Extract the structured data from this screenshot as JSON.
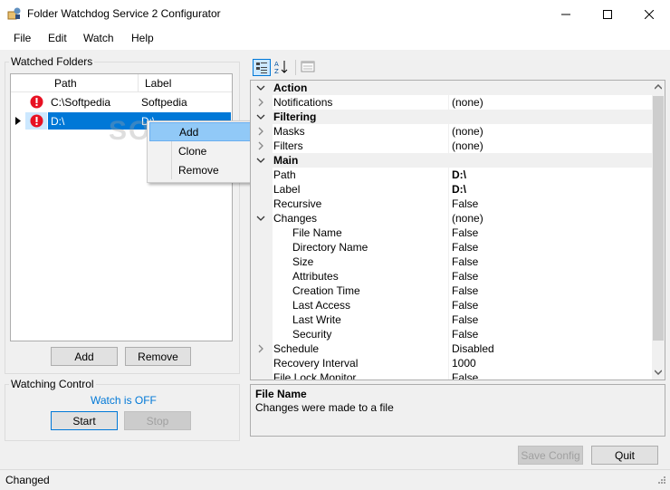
{
  "window": {
    "title": "Folder Watchdog Service 2 Configurator"
  },
  "menu": [
    "File",
    "Edit",
    "Watch",
    "Help"
  ],
  "watched_folders": {
    "label": "Watched Folders",
    "columns": [
      "Path",
      "Label"
    ],
    "rows": [
      {
        "path": "C:\\Softpedia",
        "label": "Softpedia"
      },
      {
        "path": "D:\\",
        "label": "D:\\"
      }
    ],
    "add_label": "Add",
    "remove_label": "Remove"
  },
  "context_menu": [
    "Add",
    "Clone",
    "Remove"
  ],
  "watching_control": {
    "label": "Watching Control",
    "status": "Watch is OFF",
    "start_label": "Start",
    "stop_label": "Stop"
  },
  "property_grid": {
    "rows": [
      {
        "type": "cat",
        "name": "Action"
      },
      {
        "type": "prop",
        "name": "Notifications",
        "value": "(none)",
        "expander": "right"
      },
      {
        "type": "cat",
        "name": "Filtering"
      },
      {
        "type": "prop",
        "name": "Masks",
        "value": "(none)",
        "expander": "right"
      },
      {
        "type": "prop",
        "name": "Filters",
        "value": "(none)",
        "expander": "right"
      },
      {
        "type": "cat",
        "name": "Main"
      },
      {
        "type": "prop",
        "name": "Path",
        "value": "D:\\",
        "bold": true
      },
      {
        "type": "prop",
        "name": "Label",
        "value": "D:\\",
        "bold": true
      },
      {
        "type": "prop",
        "name": "Recursive",
        "value": "False"
      },
      {
        "type": "prop",
        "name": "Changes",
        "value": "(none)",
        "expander": "down"
      },
      {
        "type": "sub",
        "name": "File Name",
        "value": "False"
      },
      {
        "type": "sub",
        "name": "Directory Name",
        "value": "False"
      },
      {
        "type": "sub",
        "name": "Size",
        "value": "False"
      },
      {
        "type": "sub",
        "name": "Attributes",
        "value": "False"
      },
      {
        "type": "sub",
        "name": "Creation Time",
        "value": "False"
      },
      {
        "type": "sub",
        "name": "Last Access",
        "value": "False"
      },
      {
        "type": "sub",
        "name": "Last Write",
        "value": "False"
      },
      {
        "type": "sub",
        "name": "Security",
        "value": "False"
      },
      {
        "type": "prop",
        "name": "Schedule",
        "value": "Disabled",
        "expander": "right"
      },
      {
        "type": "prop",
        "name": "Recovery Interval",
        "value": "1000"
      },
      {
        "type": "prop",
        "name": "File Lock Monitor",
        "value": "False"
      }
    ]
  },
  "help_panel": {
    "title": "File Name",
    "description": "Changes were made to a file"
  },
  "buttons": {
    "save_config": "Save Config",
    "quit": "Quit"
  },
  "status_bar": {
    "text": "Changed"
  },
  "watermark": "SOFTPEDIA",
  "colors": {
    "selection": "#0078d7",
    "link_status": "#0078d7",
    "error_icon": "#e81123"
  }
}
